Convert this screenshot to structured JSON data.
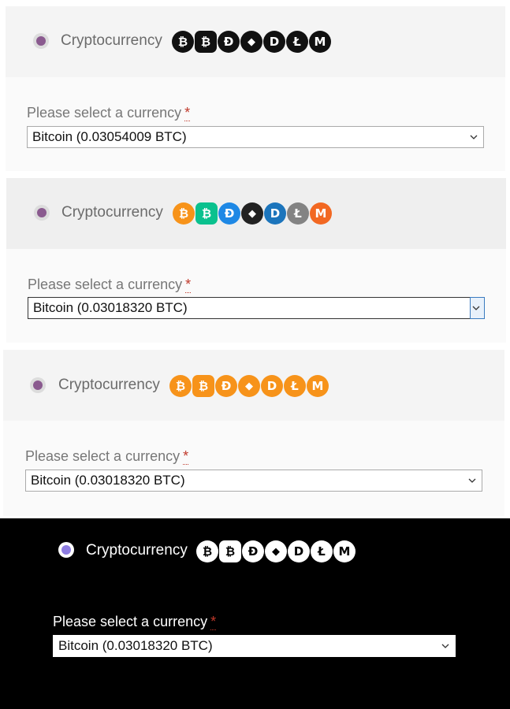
{
  "panels": [
    {
      "radio_label": "Cryptocurrency",
      "field_label": "Please select a currency",
      "required_mark": "*",
      "selected_value": "Bitcoin (0.03054009 BTC)",
      "icon_style": "black",
      "focused": false
    },
    {
      "radio_label": "Cryptocurrency",
      "field_label": "Please select a currency",
      "required_mark": "*",
      "selected_value": "Bitcoin (0.03018320 BTC)",
      "icon_style": "brand-colors",
      "focused": true
    },
    {
      "radio_label": "Cryptocurrency",
      "field_label": "Please select a currency",
      "required_mark": "*",
      "selected_value": "Bitcoin (0.03018320 BTC)",
      "icon_style": "orange",
      "focused": false
    },
    {
      "radio_label": "Cryptocurrency",
      "field_label": "Please select a currency",
      "required_mark": "*",
      "selected_value": "Bitcoin (0.03018320 BTC)",
      "icon_style": "white-on-dark",
      "focused": false
    }
  ],
  "coins": [
    {
      "name": "bitcoin-icon",
      "glyph": "₿"
    },
    {
      "name": "bitcoin-cash-icon",
      "glyph": "₿"
    },
    {
      "name": "dogecoin-icon",
      "glyph": "Đ"
    },
    {
      "name": "ethereum-icon",
      "glyph": "◆"
    },
    {
      "name": "dash-icon",
      "glyph": "D"
    },
    {
      "name": "litecoin-icon",
      "glyph": "Ł"
    },
    {
      "name": "monero-icon",
      "glyph": "M"
    }
  ],
  "colors": {
    "black": [
      "#111111",
      "#111111",
      "#111111",
      "#111111",
      "#111111",
      "#111111",
      "#111111"
    ],
    "brand-colors": [
      "#f7931a",
      "#0ac18e",
      "#1e88e5",
      "#222222",
      "#1c75bc",
      "#838383",
      "#f26822"
    ],
    "orange": [
      "#f7931a",
      "#f7931a",
      "#f7931a",
      "#f7931a",
      "#f7931a",
      "#f7931a",
      "#f7931a"
    ],
    "white-on-dark": [
      "#ffffff",
      "#ffffff",
      "#ffffff",
      "#ffffff",
      "#ffffff",
      "#ffffff",
      "#ffffff"
    ],
    "radio_accent_light": "#8a5a8f",
    "radio_accent_dark": "#8e7de2",
    "required": "#c0392b"
  }
}
